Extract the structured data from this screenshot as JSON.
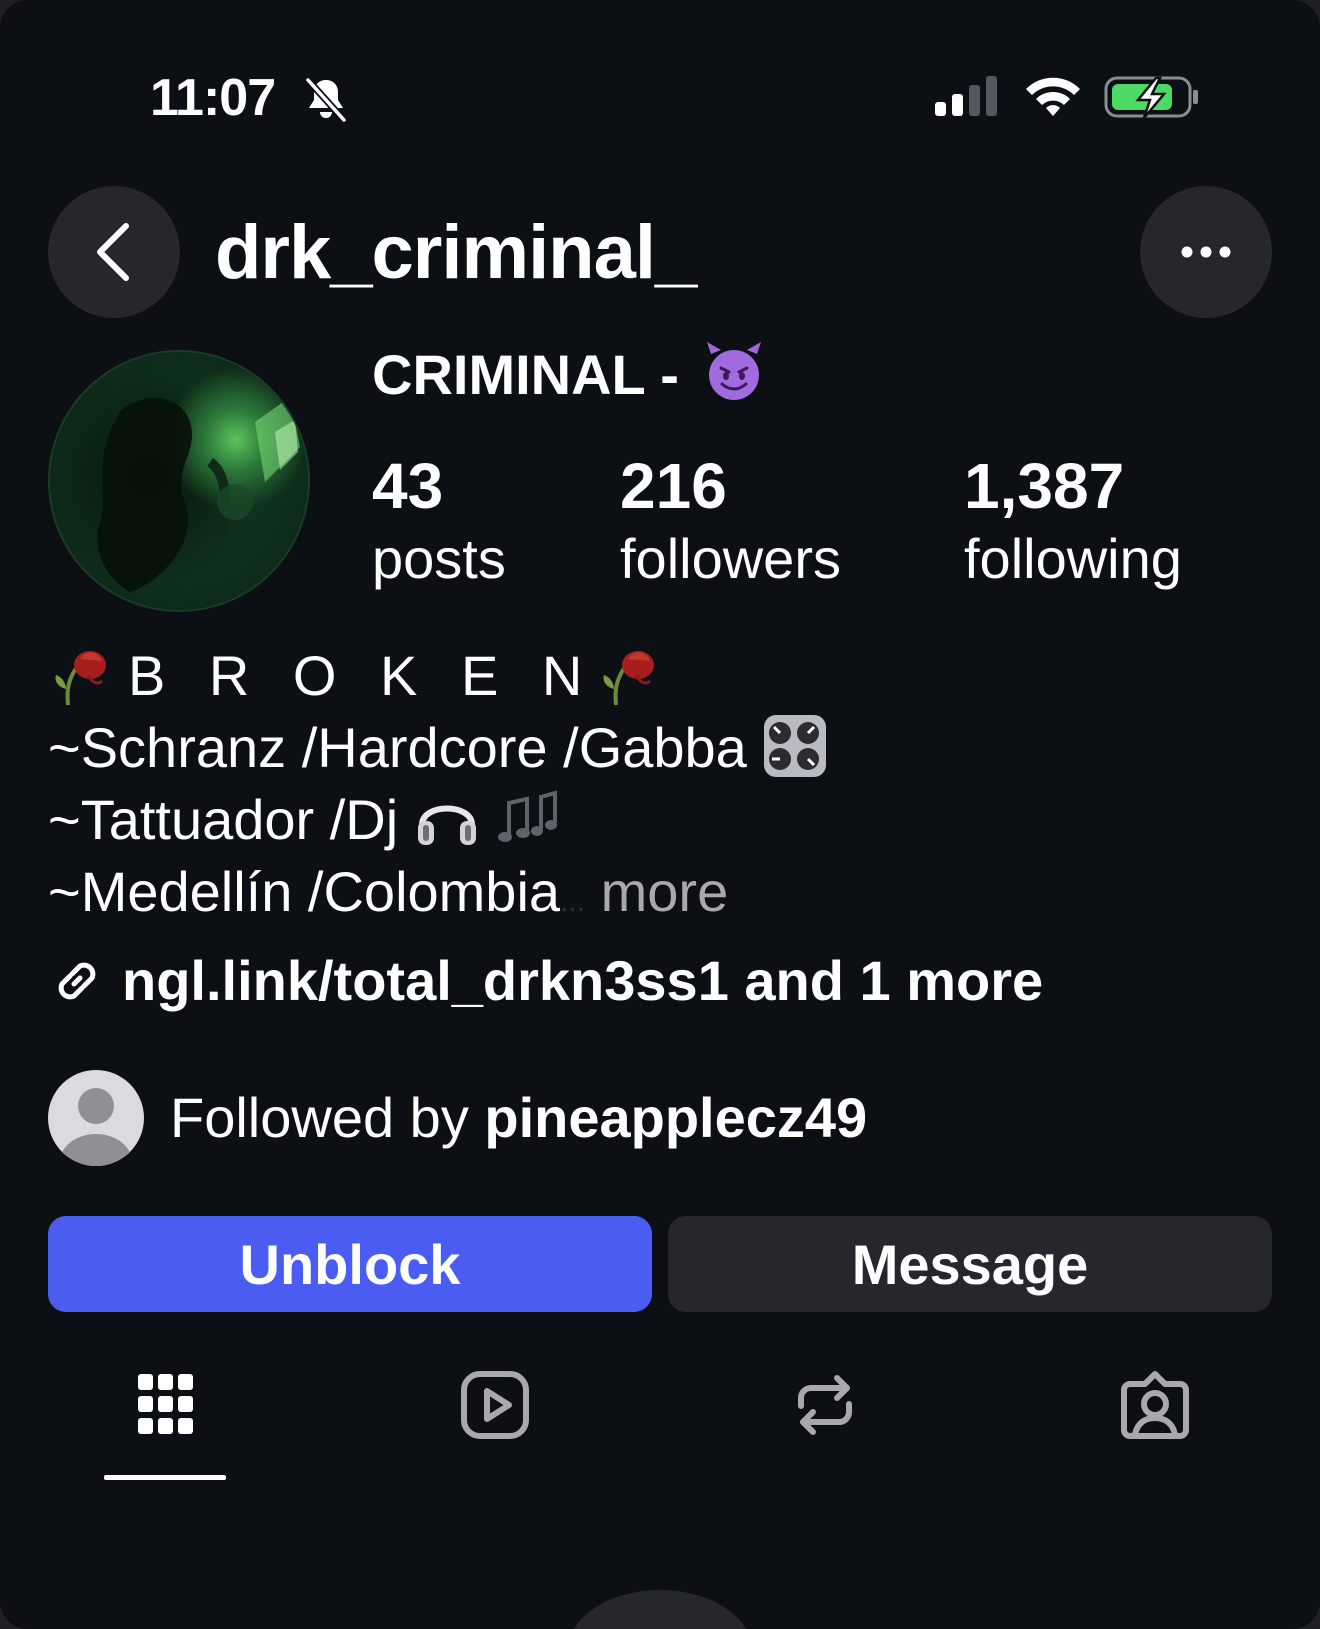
{
  "status_bar": {
    "time": "11:07"
  },
  "header": {
    "username": "drk_criminal_"
  },
  "profile": {
    "display_name": "CRIMINAL -",
    "stats": [
      {
        "value": "43",
        "label": "posts"
      },
      {
        "value": "216",
        "label": "followers"
      },
      {
        "value": "1,387",
        "label": "following"
      }
    ]
  },
  "bio": {
    "line1": "B R O K E N",
    "line2": "~Schranz /Hardcore /Gabba",
    "line3": "~Tattuador /Dj",
    "line4": "~Medellín /Colombia",
    "ellipsis": "...",
    "more": "more"
  },
  "link": {
    "text": "ngl.link/total_drkn3ss1 and 1 more"
  },
  "followed_by": {
    "prefix": "Followed by",
    "user": "pineapplecz49"
  },
  "actions": {
    "unblock": "Unblock",
    "message": "Message"
  },
  "colors": {
    "background": "#0c0f14",
    "primary_button": "#4a5df0",
    "secondary_button": "#25272c",
    "muted_text": "#a7a9ad"
  },
  "icons": {
    "back": "chevron-left-icon",
    "options": "more-horizontal-icon",
    "link": "link-icon",
    "tabs": [
      "grid-icon",
      "reels-icon",
      "reposts-icon",
      "tagged-icon"
    ]
  }
}
